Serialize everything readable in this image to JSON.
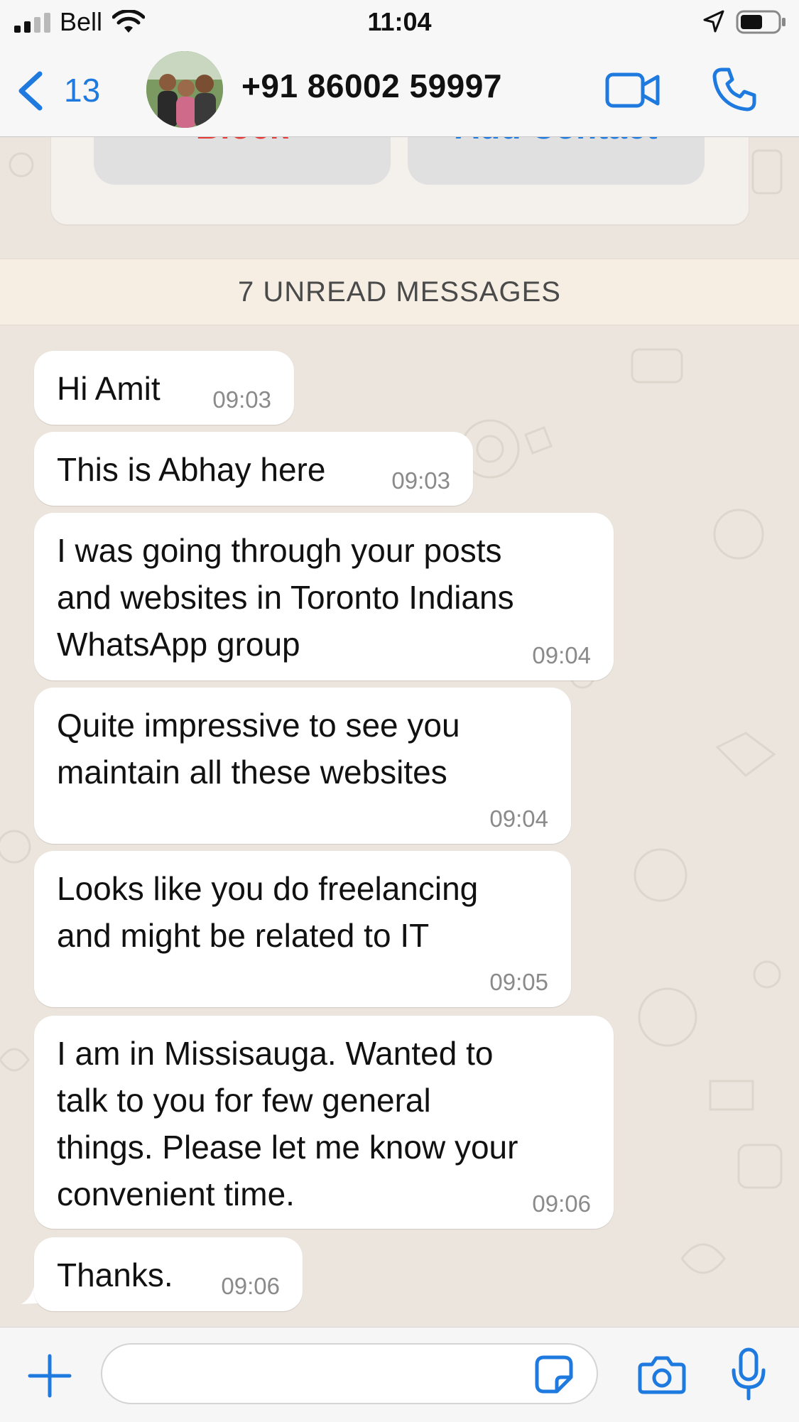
{
  "status_bar": {
    "carrier": "Bell",
    "time": "11:04",
    "icons": [
      "signal-icon",
      "wifi-icon",
      "location-arrow-icon",
      "battery-icon"
    ]
  },
  "header": {
    "back_count": "13",
    "contact_name": "+91 86002 59997",
    "icons": [
      "chevron-left-icon",
      "video-call-icon",
      "phone-icon"
    ]
  },
  "security_card": {
    "block_label": "Block",
    "add_contact_label": "Add Contact"
  },
  "unread_banner": "7 UNREAD MESSAGES",
  "messages": [
    {
      "text": "Hi Amit",
      "time": "09:03"
    },
    {
      "text": "This is Abhay here",
      "time": "09:03"
    },
    {
      "text": "I was going through your posts\nand websites in Toronto Indians\nWhatsApp group",
      "time": "09:04"
    },
    {
      "text": "Quite impressive to see you\nmaintain all these websites",
      "time": "09:04"
    },
    {
      "text": "Looks like you do freelancing\nand might be related to IT",
      "time": "09:05"
    },
    {
      "text": "I am in Missisauga. Wanted to\ntalk to you for few general\nthings. Please let me know your\nconvenient time.",
      "time": "09:06"
    },
    {
      "text": "Thanks.",
      "time": "09:06"
    }
  ],
  "input_bar": {
    "placeholder": "",
    "icons": [
      "plus-icon",
      "sticker-icon",
      "camera-icon",
      "microphone-icon"
    ]
  },
  "colors": {
    "accent": "#1f7ae0",
    "block": "#e53935",
    "chat_background": "#ece5dd",
    "bubble": "#ffffff",
    "unread_banner": "#f6eee3"
  }
}
